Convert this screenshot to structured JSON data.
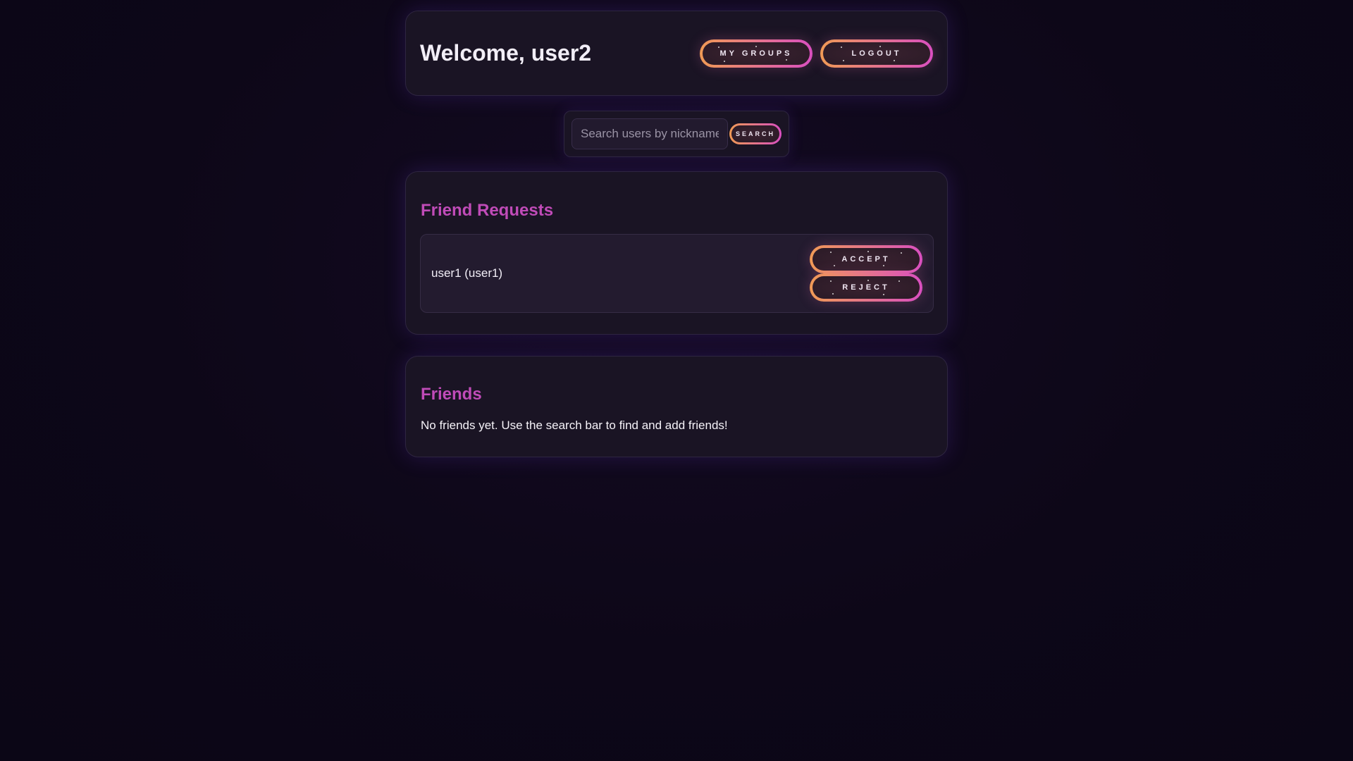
{
  "header": {
    "welcome": "Welcome, user2",
    "my_groups_label": "MY GROUPS",
    "logout_label": "LOGOUT"
  },
  "search": {
    "placeholder": "Search users by nickname",
    "value": "",
    "button_label": "SEARCH"
  },
  "friend_requests": {
    "title": "Friend Requests",
    "items": [
      {
        "name": "user1 (user1)",
        "accept_label": "ACCEPT",
        "reject_label": "REJECT"
      }
    ]
  },
  "friends": {
    "title": "Friends",
    "empty_message": "No friends yet. Use the search bar to find and add friends!"
  },
  "colors": {
    "background": "#0d0718",
    "card": "#1a1424",
    "accent_title": "#c04bb8",
    "button_gradient_start": "#f09a55",
    "button_gradient_end": "#d94fc0"
  }
}
